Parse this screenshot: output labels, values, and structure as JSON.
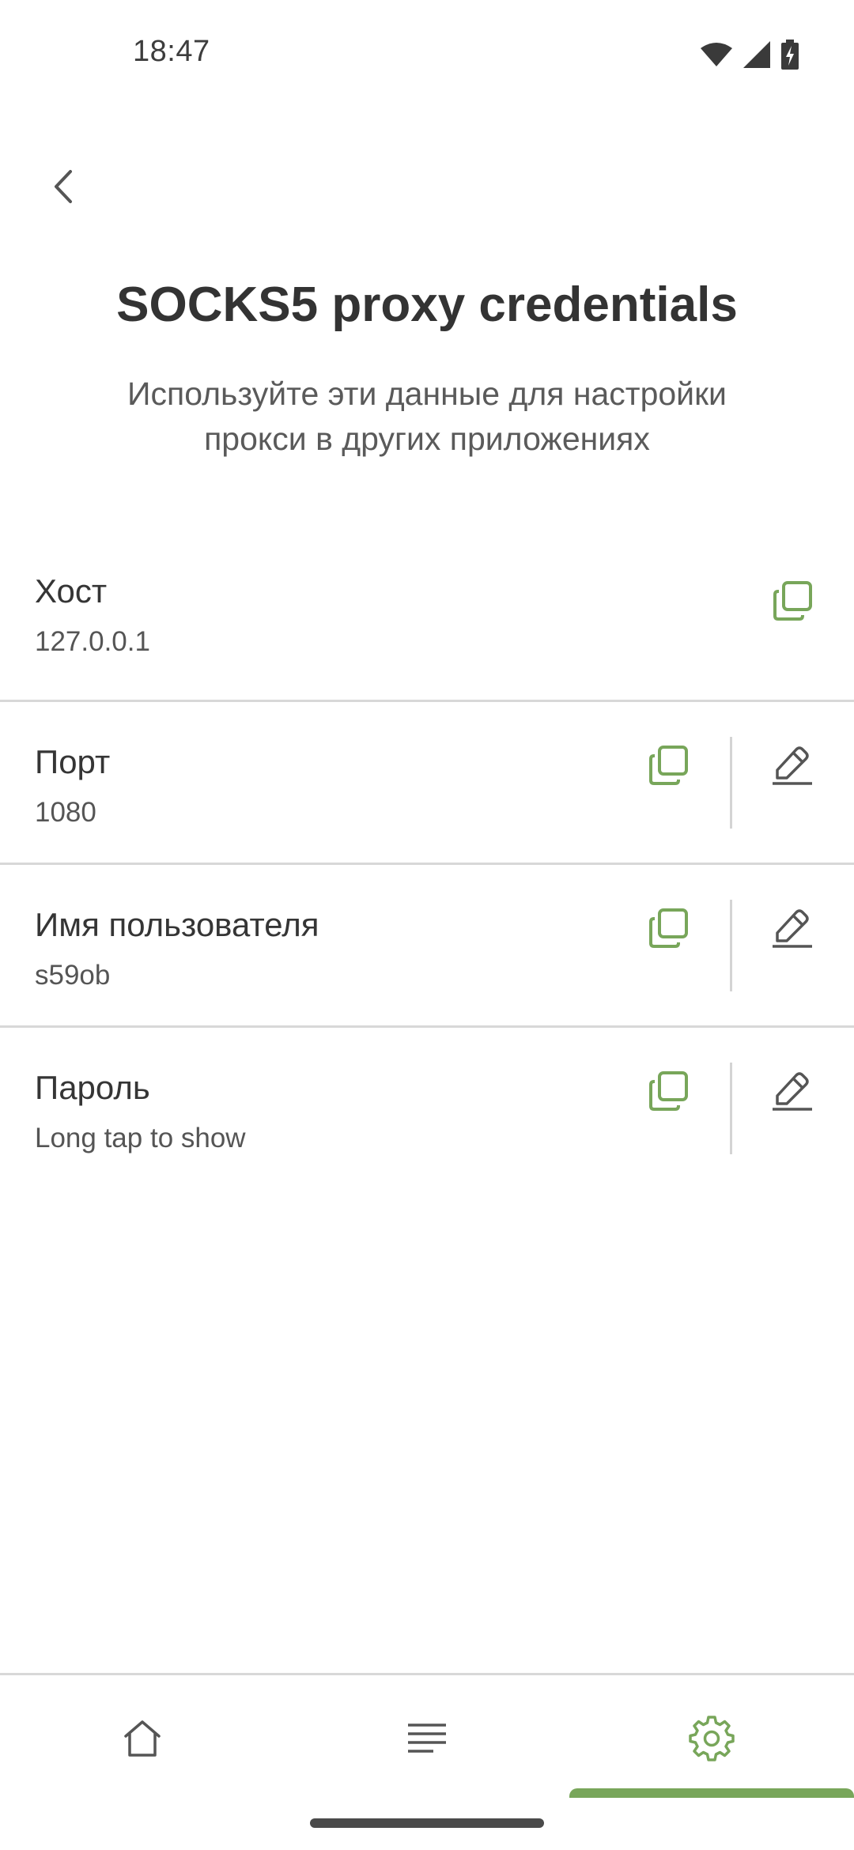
{
  "status_bar": {
    "time": "18:47",
    "icons": [
      "wifi-icon",
      "signal-icon",
      "battery-charging-icon"
    ]
  },
  "header": {
    "back_icon": "chevron-left-icon",
    "title": "SOCKS5 proxy credentials",
    "subtitle": "Используйте эти данные для настройки прокси в других приложениях"
  },
  "credentials": [
    {
      "label": "Хост",
      "value": "127.0.0.1",
      "copy_icon": "copy-icon"
    },
    {
      "label": "Порт",
      "value": "1080",
      "copy_icon": "copy-icon",
      "edit_icon": "pencil-icon"
    },
    {
      "label": "Имя пользователя",
      "value": "s59ob",
      "copy_icon": "copy-icon",
      "edit_icon": "pencil-icon"
    },
    {
      "label": "Пароль",
      "value": "Long tap to show",
      "copy_icon": "copy-icon",
      "edit_icon": "pencil-icon"
    }
  ],
  "bottom_nav": {
    "items": [
      {
        "icon": "home-icon",
        "active": false
      },
      {
        "icon": "list-icon",
        "active": false
      },
      {
        "icon": "gear-icon",
        "active": true
      }
    ]
  },
  "colors": {
    "accent": "#78a65a",
    "text": "#353535",
    "divider": "#d8d8d8",
    "icon_gray": "#555555"
  }
}
